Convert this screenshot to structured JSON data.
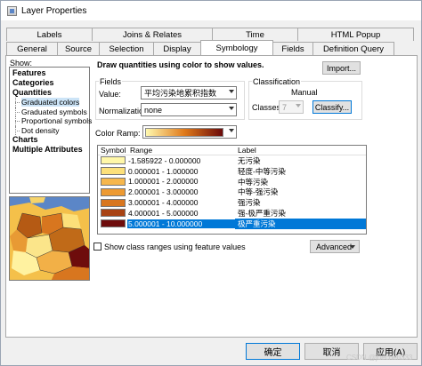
{
  "window": {
    "title": "Layer Properties"
  },
  "tabs_top": [
    "Labels",
    "Joins & Relates",
    "Time",
    "HTML Popup"
  ],
  "tabs_bottom": [
    "General",
    "Source",
    "Selection",
    "Display",
    "Symbology",
    "Fields",
    "Definition Query"
  ],
  "show": {
    "label": "Show:",
    "items": [
      {
        "label": "Features",
        "level": 0
      },
      {
        "label": "Categories",
        "level": 0
      },
      {
        "label": "Quantities",
        "level": 0
      },
      {
        "label": "Graduated colors",
        "level": 1,
        "selected": true
      },
      {
        "label": "Graduated symbols",
        "level": 1
      },
      {
        "label": "Proportional symbols",
        "level": 1
      },
      {
        "label": "Dot density",
        "level": 1
      },
      {
        "label": "Charts",
        "level": 0
      },
      {
        "label": "Multiple Attributes",
        "level": 0
      }
    ]
  },
  "description": "Draw quantities using color to show values.",
  "import_label": "Import...",
  "fields": {
    "group_label": "Fields",
    "value_label": "Value:",
    "value": "平均污染地累积指数",
    "normalization_label": "Normalization:",
    "normalization": "none"
  },
  "classification": {
    "group_label": "Classification",
    "method": "Manual",
    "classes_label": "Classes:",
    "classes": "7",
    "classify_label": "Classify..."
  },
  "color_ramp": {
    "label": "Color Ramp:",
    "from": "#fff9b0",
    "mid": "#e07a1a",
    "to": "#6b0a0a"
  },
  "table": {
    "headers": [
      "Symbol",
      "Range",
      "Label"
    ],
    "rows": [
      {
        "color": "#fff7a8",
        "range": "-1.585922 - 0.000000",
        "label": "无污染"
      },
      {
        "color": "#fce07a",
        "range": "0.000001 - 1.000000",
        "label": "轻度-中等污染"
      },
      {
        "color": "#f6b74d",
        "range": "1.000001 - 2.000000",
        "label": "中等污染"
      },
      {
        "color": "#ed9a32",
        "range": "2.000001 - 3.000000",
        "label": "中等-强污染"
      },
      {
        "color": "#d8761f",
        "range": "3.000001 - 4.000000",
        "label": "强污染"
      },
      {
        "color": "#a84314",
        "range": "4.000001 - 5.000000",
        "label": "强-极严重污染"
      },
      {
        "color": "#6e0c0c",
        "range": "5.000001 - 10.000000",
        "label": "极严重污染",
        "selected": true
      }
    ]
  },
  "show_feature_values": {
    "label": "Show class ranges using feature values",
    "checked": false
  },
  "advanced_label": "Advanced",
  "buttons": {
    "ok": "确定",
    "cancel": "取消",
    "apply": "应用(A)"
  },
  "watermark": "CSDN @juechen333"
}
